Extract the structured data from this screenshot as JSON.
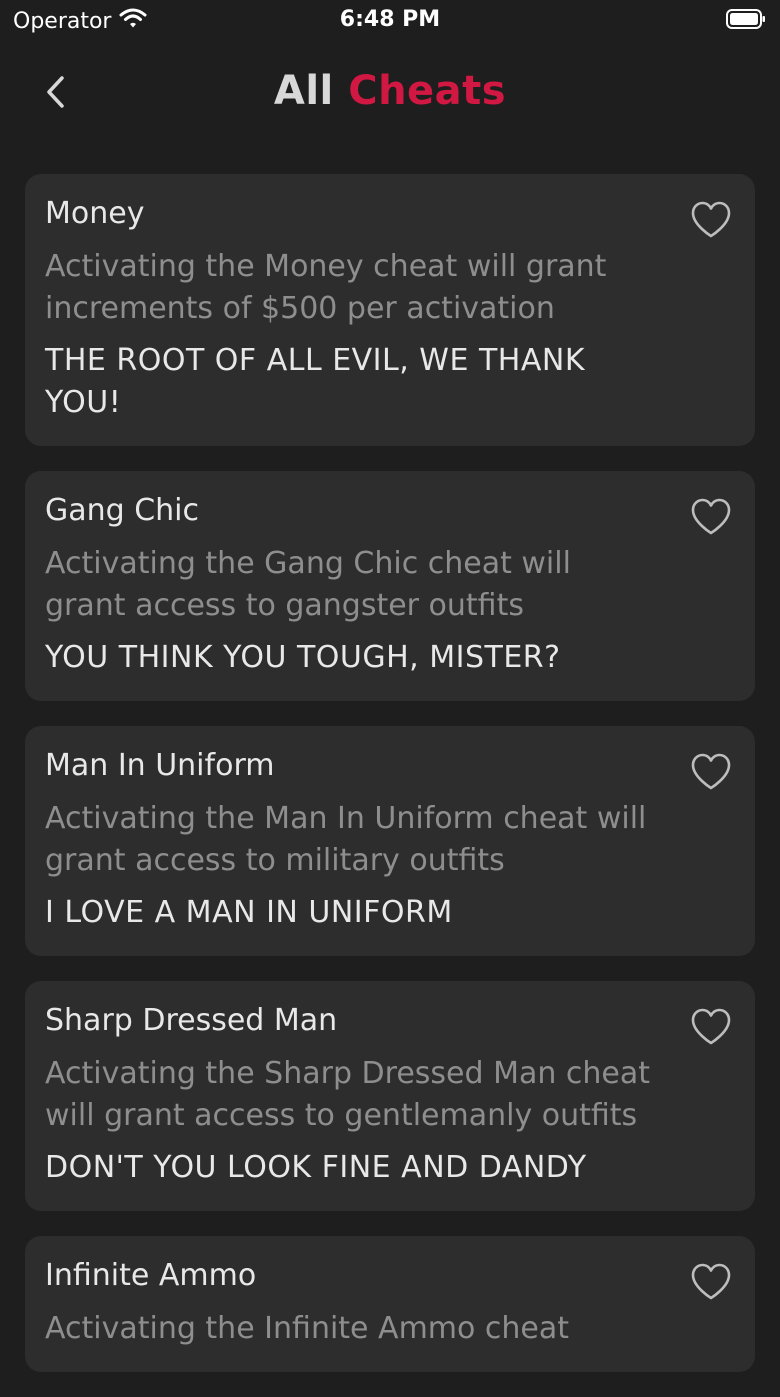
{
  "status_bar": {
    "carrier": "Operator",
    "time": "6:48 PM"
  },
  "header": {
    "title_part1": "All",
    "title_part2": "Cheats",
    "accent_color": "#d01842"
  },
  "cheats": [
    {
      "name": "Money",
      "description": "Activating the Money cheat will grant increments of $500 per activation",
      "code": "THE ROOT OF ALL EVIL, WE THANK YOU!"
    },
    {
      "name": "Gang Chic",
      "description": "Activating the Gang Chic cheat will grant access to gangster outfits",
      "code": "YOU THINK YOU TOUGH, MISTER?"
    },
    {
      "name": "Man In Uniform",
      "description": "Activating the Man In Uniform cheat will grant access to military outfits",
      "code": "I LOVE A MAN IN UNIFORM"
    },
    {
      "name": "Sharp Dressed Man",
      "description": "Activating the Sharp Dressed Man cheat will grant access to gentlemanly outfits",
      "code": "DON'T YOU LOOK FINE AND DANDY"
    },
    {
      "name": "Infinite Ammo",
      "description": "Activating the Infinite Ammo cheat",
      "code": ""
    }
  ],
  "icons": {
    "back": "chevron-left-icon",
    "favorite": "heart-outline-icon",
    "wifi": "wifi-icon",
    "battery": "battery-icon"
  }
}
